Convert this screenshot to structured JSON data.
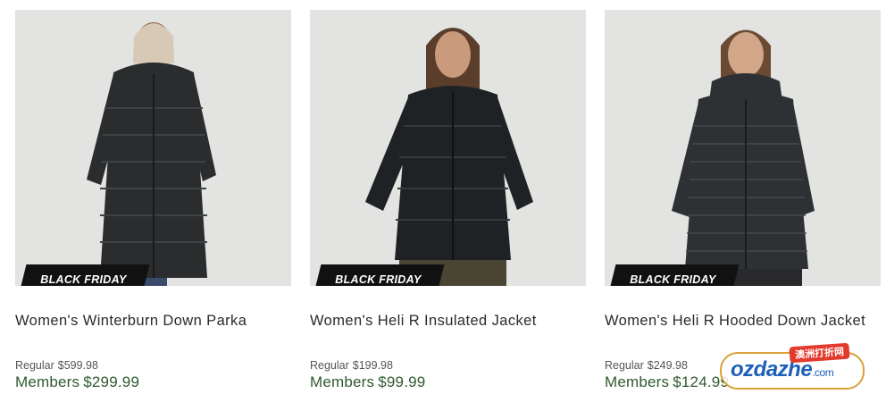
{
  "products": [
    {
      "badge": "BLACK FRIDAY",
      "name": "Women's Winterburn Down Parka",
      "regular_label": "Regular",
      "regular_price": "$599.98",
      "member_label": "Members",
      "member_price": "$299.99",
      "jacket_color": "#2a2c2e"
    },
    {
      "badge": "BLACK FRIDAY",
      "name": "Women's Heli R Insulated Jacket",
      "regular_label": "Regular",
      "regular_price": "$199.98",
      "member_label": "Members",
      "member_price": "$99.99",
      "jacket_color": "#1f2224"
    },
    {
      "badge": "BLACK FRIDAY",
      "name": "Women's Heli R Hooded Down Jacket",
      "regular_label": "Regular",
      "regular_price": "$249.98",
      "member_label": "Members",
      "member_price": "$124.99",
      "jacket_color": "#2e3134"
    }
  ],
  "watermark": {
    "brand": "ozdazhe",
    "domain": ".com",
    "cn": "澳洲打折网"
  },
  "colors": {
    "member_price": "#2f5a2f",
    "badge_bg": "#111111",
    "photo_bg": "#e3e3e1"
  }
}
